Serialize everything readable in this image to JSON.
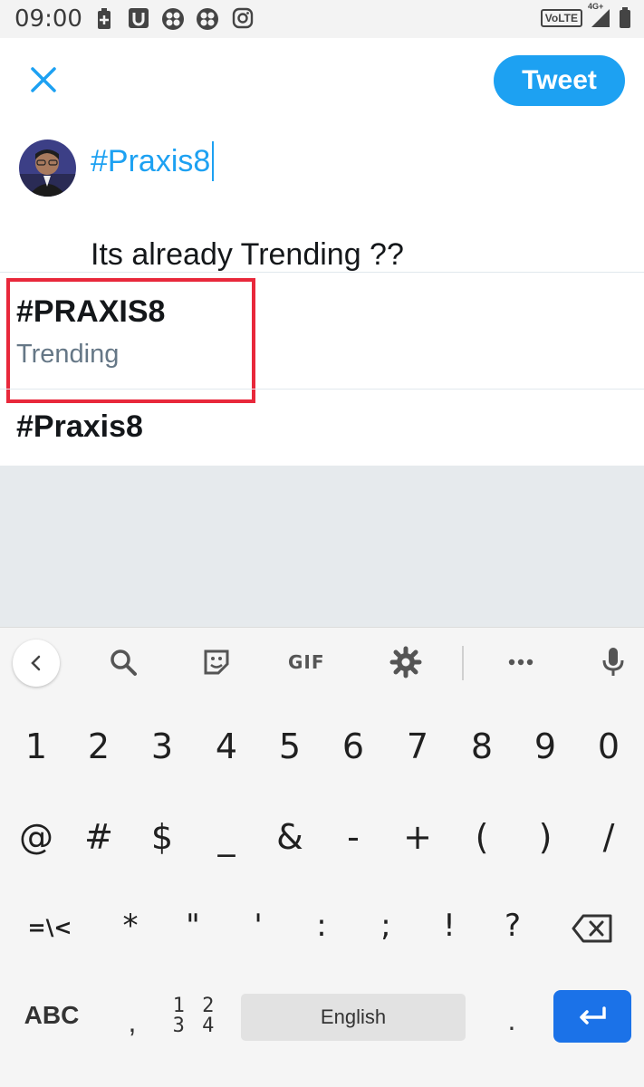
{
  "status_bar": {
    "time": "09:00",
    "network": "VoLTE",
    "signal_label": "4G+"
  },
  "compose": {
    "close_icon": "close-icon",
    "tweet_button": "Tweet",
    "text_line1": "#Praxis8",
    "text_line2": "Its already Trending ??"
  },
  "suggestions": [
    {
      "title": "#PRAXIS8",
      "subtitle": "Trending"
    },
    {
      "title": "#Praxis8"
    }
  ],
  "keyboard": {
    "toolbar": [
      "back-icon",
      "search-icon",
      "sticker-icon",
      "GIF",
      "settings-icon",
      "more-icon",
      "mic-icon"
    ],
    "gif_label": "GIF",
    "row_numbers": [
      "1",
      "2",
      "3",
      "4",
      "5",
      "6",
      "7",
      "8",
      "9",
      "0"
    ],
    "row_symbols": [
      "@",
      "#",
      "$",
      "_",
      "&",
      "-",
      "+",
      "(",
      ")",
      "/"
    ],
    "row_symbols2": [
      "=\\<",
      "*",
      "\"",
      "'",
      ":",
      ";",
      "!",
      "?"
    ],
    "abc_label": "ABC",
    "comma": ",",
    "nums_label_top": "1 2",
    "nums_label_bottom": "3 4",
    "space_label": "English",
    "period": "."
  },
  "colors": {
    "accent": "#1da1f2",
    "highlight_box": "#e8283b",
    "enter_key": "#1b72e8"
  }
}
